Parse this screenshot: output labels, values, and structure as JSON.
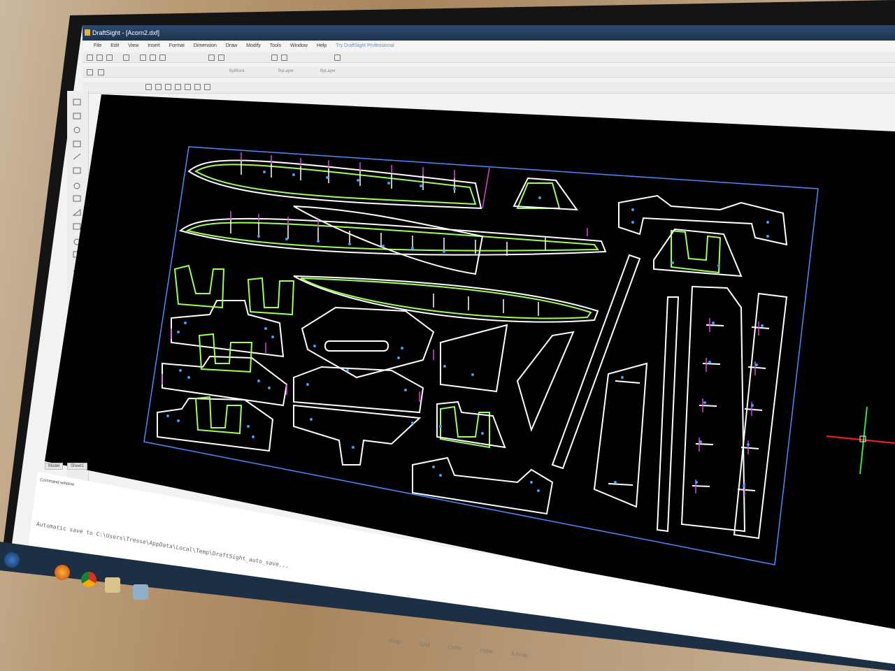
{
  "window": {
    "title": "DraftSight - [Acorn2.dxf]"
  },
  "menu": {
    "items": [
      "File",
      "Edit",
      "View",
      "Insert",
      "Format",
      "Dimension",
      "Draw",
      "Modify",
      "Tools",
      "Window",
      "Help"
    ],
    "promo": "Try DraftSight Professional"
  },
  "properties_toolbar": {
    "layer_value": "ByBlock",
    "linestyle_value": "ByLayer",
    "lineweight_value": "ByLayer"
  },
  "tabs": [
    "Model",
    "Sheet1"
  ],
  "command_window": {
    "title": "Command window",
    "message": "Automatic save to C:\\Users\\Tresse\\AppData\\Local\\Temp\\DraftSight_auto_save..."
  },
  "status_bar": {
    "items": [
      "Snap",
      "Grid",
      "Ortho",
      "Polar",
      "ESnap"
    ]
  },
  "colors": {
    "canvas": "#000000",
    "boundary": "#4a8cff",
    "cut_lines": "#ffffff",
    "inner_parts": "#9cff5a",
    "tabs_magenta": "#e040e0",
    "holes": "#3aa0ff",
    "crosshair_x": "#ff2020",
    "crosshair_y": "#40e040"
  },
  "icons": [
    "draftsight-app-icon",
    "windows-start-icon",
    "firefox-icon",
    "chrome-icon",
    "explorer-icon",
    "draftsight-taskbar-icon"
  ]
}
